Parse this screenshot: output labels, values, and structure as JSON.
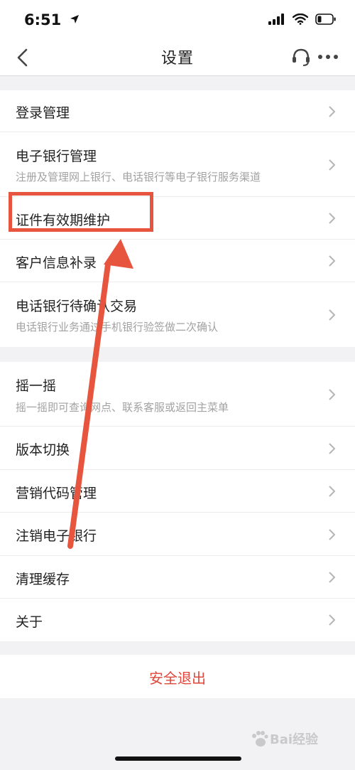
{
  "status": {
    "time": "6:51"
  },
  "nav": {
    "title": "设置"
  },
  "groups": [
    {
      "rows": [
        {
          "title": "登录管理"
        },
        {
          "title": "电子银行管理",
          "subtitle": "注册及管理网上银行、电话银行等电子银行服务渠道"
        },
        {
          "title": "证件有效期维护"
        },
        {
          "title": "客户信息补录"
        },
        {
          "title": "电话银行待确认交易",
          "subtitle": "电话银行业务通过手机银行验签做二次确认"
        }
      ]
    },
    {
      "rows": [
        {
          "title": "摇一摇",
          "subtitle": "摇一摇即可查询网点、联系客服或返回主菜单"
        },
        {
          "title": "版本切换"
        },
        {
          "title": "营销代码管理"
        },
        {
          "title": "注销电子银行"
        },
        {
          "title": "清理缓存"
        },
        {
          "title": "关于"
        }
      ]
    }
  ],
  "logout": {
    "label": "安全退出"
  },
  "watermark": {
    "text": "Bai经验"
  },
  "colors": {
    "accent": "#e8553e",
    "logout": "#e0463a",
    "background": "#f2f2f4"
  }
}
